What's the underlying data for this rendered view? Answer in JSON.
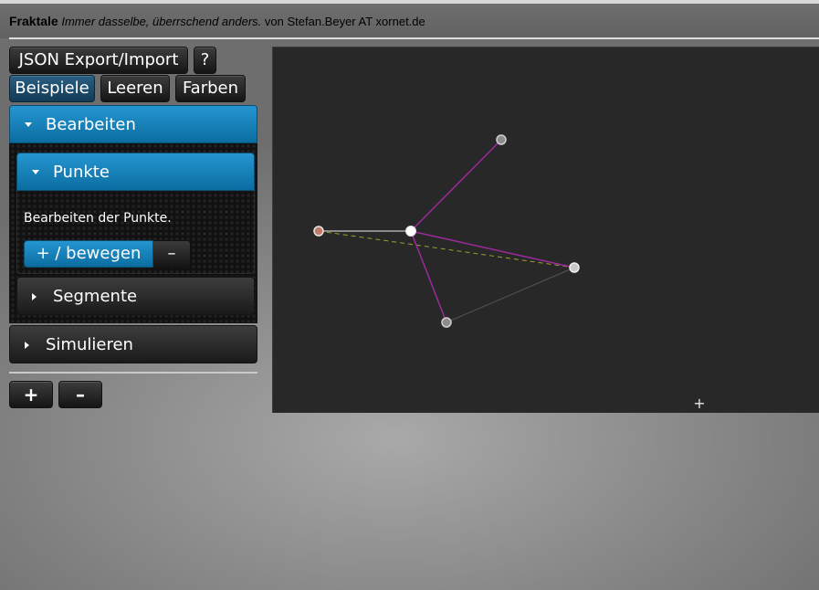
{
  "header": {
    "app_name": "Fraktale",
    "tagline": "Immer dasselbe, überrschend anders.",
    "credit": "von Stefan.Beyer AT xornet.de"
  },
  "toolbar": {
    "json_label": "JSON Export/Import",
    "help_label": "?",
    "examples_label": "Beispiele",
    "clear_label": "Leeren",
    "colors_label": "Farben"
  },
  "accordion": {
    "edit_label": "Bearbeiten",
    "points_label": "Punkte",
    "points_description": "Bearbeiten der Punkte.",
    "add_move_label": "+ / bewegen",
    "remove_label": "–",
    "segments_label": "Segmente",
    "simulate_label": "Simulieren"
  },
  "zoom": {
    "plus_label": "+",
    "minus_label": "–"
  },
  "canvas": {
    "cursor_label": "+",
    "background": "#282828",
    "segment_color": "#9b2a9b",
    "guide_color": "#9aa02a",
    "base_line_color": "#8a8a8a"
  }
}
